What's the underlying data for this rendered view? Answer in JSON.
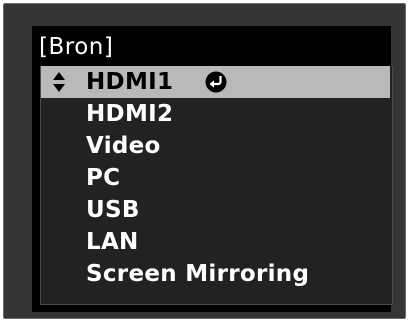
{
  "title": "[Bron]",
  "menu": {
    "items": [
      {
        "label": "HDMI1"
      },
      {
        "label": "HDMI2"
      },
      {
        "label": "Video"
      },
      {
        "label": "PC"
      },
      {
        "label": "USB"
      },
      {
        "label": "LAN"
      },
      {
        "label": "Screen Mirroring"
      }
    ],
    "selected_icon": "up-down-arrows-icon",
    "enter_icon": "enter-icon"
  },
  "colors": {
    "frame": "#353535",
    "window": "#000000",
    "list_background": "#222222",
    "highlight": "#b9b9b9",
    "text": "#ffffff"
  }
}
